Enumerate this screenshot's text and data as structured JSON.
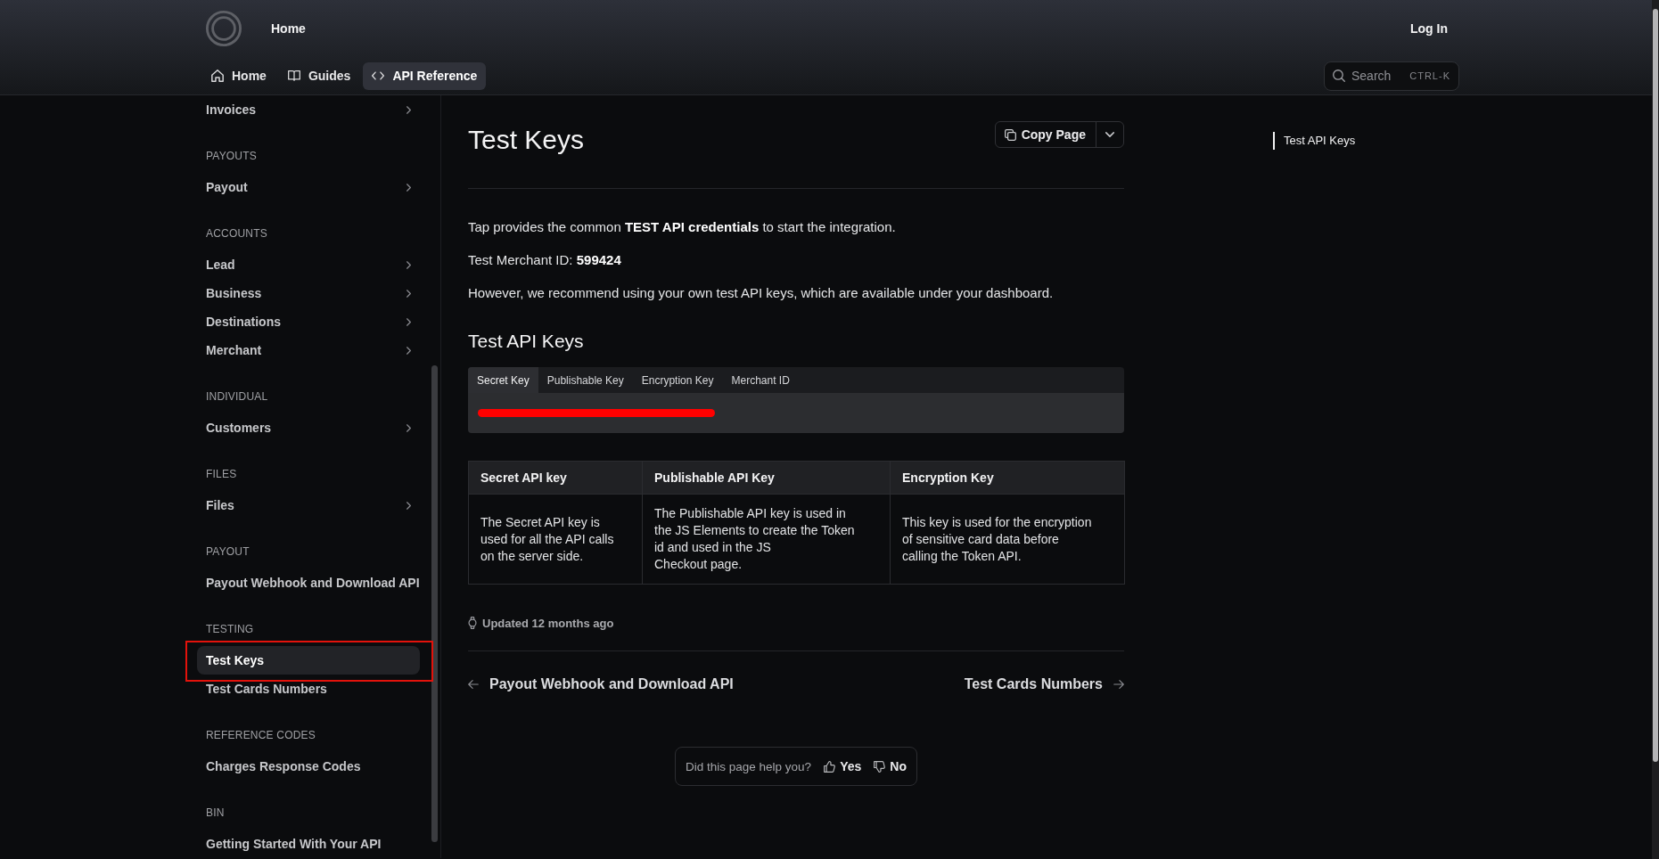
{
  "header": {
    "home_link": "Home",
    "login": "Log In"
  },
  "nav_tabs": [
    {
      "label": "Home",
      "kind": "home",
      "selected": false
    },
    {
      "label": "Guides",
      "kind": "book",
      "selected": false
    },
    {
      "label": "API Reference",
      "kind": "code",
      "selected": true
    }
  ],
  "search": {
    "placeholder": "Search",
    "shortcut": "CTRL-K"
  },
  "sidebar": {
    "sections": [
      {
        "items": [
          {
            "label": "Invoices",
            "expandable": true,
            "selected": false,
            "outlined": false
          }
        ]
      },
      {
        "title": "PAYOUTS",
        "items": [
          {
            "label": "Payout",
            "expandable": true,
            "selected": false,
            "outlined": false
          }
        ]
      },
      {
        "title": "ACCOUNTS",
        "items": [
          {
            "label": "Lead",
            "expandable": true,
            "selected": false,
            "outlined": false
          },
          {
            "label": "Business",
            "expandable": true,
            "selected": false,
            "outlined": false
          },
          {
            "label": "Destinations",
            "expandable": true,
            "selected": false,
            "outlined": false
          },
          {
            "label": "Merchant",
            "expandable": true,
            "selected": false,
            "outlined": false
          }
        ]
      },
      {
        "title": "INDIVIDUAL",
        "items": [
          {
            "label": "Customers",
            "expandable": true,
            "selected": false,
            "outlined": false
          }
        ]
      },
      {
        "title": "FILES",
        "items": [
          {
            "label": "Files",
            "expandable": true,
            "selected": false,
            "outlined": false
          }
        ]
      },
      {
        "title": "PAYOUT",
        "items": [
          {
            "label": "Payout Webhook and Download API",
            "expandable": false,
            "selected": false,
            "outlined": false
          }
        ]
      },
      {
        "title": "TESTING",
        "items": [
          {
            "label": "Test Keys",
            "expandable": false,
            "selected": true,
            "outlined": true
          },
          {
            "label": "Test Cards Numbers",
            "expandable": false,
            "selected": false,
            "outlined": false
          }
        ]
      },
      {
        "title": "REFERENCE CODES",
        "items": [
          {
            "label": "Charges Response Codes",
            "expandable": false,
            "selected": false,
            "outlined": false
          }
        ]
      },
      {
        "title": "BIN",
        "items": [
          {
            "label": "Getting Started With Your API",
            "expandable": false,
            "selected": false,
            "outlined": false
          }
        ]
      }
    ]
  },
  "page": {
    "title": "Test Keys",
    "copy_button": "Copy Page",
    "paragraphs": [
      "Tap provides the common **TEST API credentials** to start the integration.",
      "Test Merchant ID: **599424**",
      "However, we recommend using your own test API keys, which are available under your dashboard."
    ],
    "section_title": "Test API Keys",
    "code_tabs": [
      {
        "label": "Secret Key",
        "selected": true
      },
      {
        "label": "Publishable Key",
        "selected": false
      },
      {
        "label": "Encryption Key",
        "selected": false
      },
      {
        "label": "Merchant ID",
        "selected": false
      }
    ],
    "code_redacted": true,
    "table": {
      "columns": [
        "Secret API key",
        "Publishable API Key",
        "Encryption Key"
      ],
      "rows": [
        [
          "The Secret API key is used for all the API calls on the server side.",
          "The Publishable API key is used in the JS Elements to create the Token id and used in the JS\nCheckout page.",
          "This key is used for the encryption of sensitive card data before calling the Token API."
        ]
      ]
    },
    "updated": "Updated 12 months ago",
    "prev_link": "Payout Webhook and Download API",
    "next_link": "Test Cards Numbers",
    "feedback": {
      "question": "Did this page help you?",
      "yes": "Yes",
      "no": "No"
    }
  },
  "toc": [
    {
      "label": "Test API Keys",
      "selected": true
    }
  ]
}
